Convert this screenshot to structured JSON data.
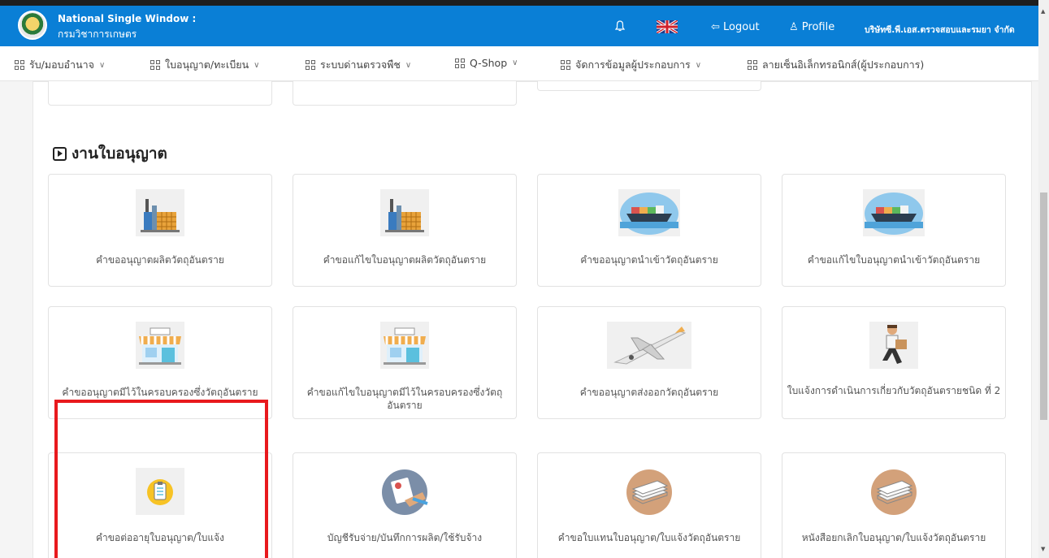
{
  "header": {
    "org_line1": "National Single Window :",
    "org_line2": "กรมวิชาการเกษตร",
    "logout": "Logout",
    "profile": "Profile",
    "company": "บริษัทซี.พี.เอส.ตรวจสอบและรมยา จำกัด",
    "accent_color": "#0a7fd6"
  },
  "nav": {
    "items": [
      "รับ/มอบอำนาจ",
      "ใบอนุญาต/ทะเบียน",
      "ระบบด่านตรวจพืช",
      "Q-Shop",
      "จัดการข้อมูลผู้ประกอบการ",
      "ลายเซ็นอิเล็กทรอนิกส์(ผู้ประกอบการ)"
    ]
  },
  "section": {
    "title": "งานใบอนุญาต"
  },
  "cards": [
    {
      "label": "คำขออนุญาตผลิตวัตถุอันตราย",
      "icon": "factory-icon"
    },
    {
      "label": "คำขอแก้ไขใบอนุญาตผลิตวัตถุอันตราย",
      "icon": "factory-icon"
    },
    {
      "label": "คำขออนุญาตนำเข้าวัตถุอันตราย",
      "icon": "cargo-ship-icon"
    },
    {
      "label": "คำขอแก้ไขใบอนุญาตนำเข้าวัตถุอันตราย",
      "icon": "cargo-ship-icon"
    },
    {
      "label": "คำขออนุญาตมีไว้ในครอบครองซึ่งวัตถุอันตราย",
      "icon": "store-icon"
    },
    {
      "label": "คำขอแก้ไขใบอนุญาตมีไว้ในครอบครองซึ่งวัตถุ อันตราย",
      "icon": "store-icon"
    },
    {
      "label": "คำขออนุญาตส่งออกวัตถุอันตราย",
      "icon": "airplane-icon"
    },
    {
      "label": "ใบแจ้งการดำเนินการเกี่ยวกับวัตถุอันตรายชนิด ที่ 2",
      "icon": "delivery-man-icon"
    },
    {
      "label": "คำขอต่ออายุใบอนุญาต/ใบแจ้ง",
      "icon": "checklist-icon"
    },
    {
      "label": "บัญชีรับจ่าย/บันทึกการผลิต/ใช้รับจ้าง",
      "icon": "document-hand-icon"
    },
    {
      "label": "คำขอใบแทนใบอนุญาต/ใบแจ้งวัตถุอันตราย",
      "icon": "paper-stack-icon"
    },
    {
      "label": "หนังสือยกเลิกใบอนุญาต/ใบแจ้งวัตถุอันตราย",
      "icon": "paper-stack-icon"
    }
  ],
  "highlight_color": "#e8191d"
}
